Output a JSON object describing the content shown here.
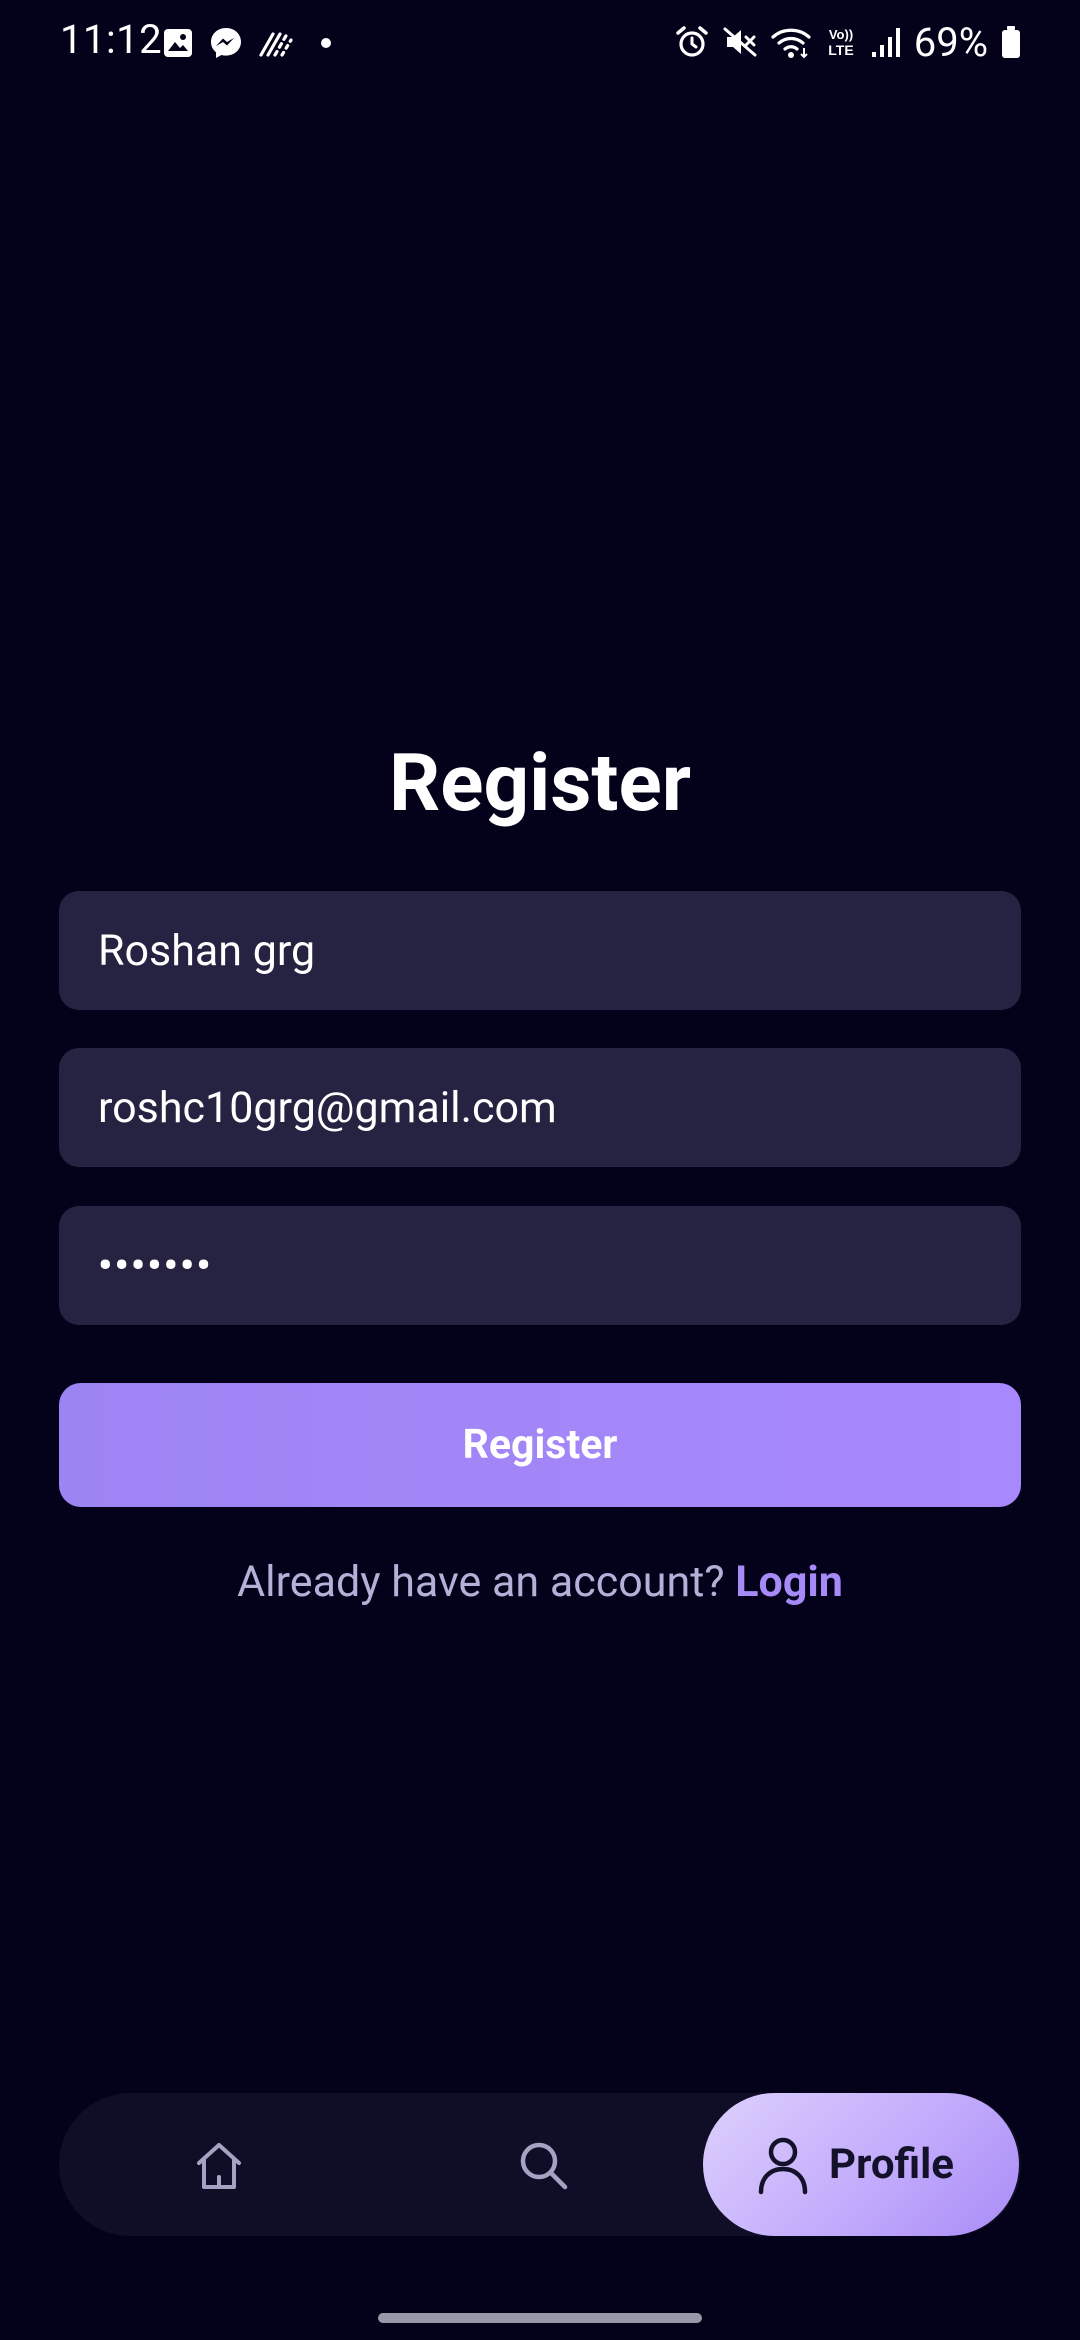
{
  "status_bar": {
    "time": "11:12",
    "battery_percent": "69%",
    "left_icons": [
      "gallery-icon",
      "messenger-icon",
      "slashes-icon",
      "dot-icon"
    ],
    "right_icons": [
      "alarm-icon",
      "mute-icon",
      "wifi-icon",
      "volte-icon",
      "signal-icon",
      "battery-icon"
    ]
  },
  "register": {
    "title": "Register",
    "name_value": "Roshan grg",
    "email_value": "roshc10grg@gmail.com",
    "password_value": "•••••••",
    "button_label": "Register",
    "login_prompt": "Already have an account?",
    "login_link": "Login"
  },
  "bottom_nav": {
    "items": [
      {
        "icon": "home-icon"
      },
      {
        "icon": "search-icon"
      },
      {
        "icon": "profile-icon",
        "label": "Profile",
        "active": true
      }
    ]
  },
  "colors": {
    "background": "#04021a",
    "field": "#252341",
    "accent": "#a68af8",
    "button": "#a889fd",
    "nav_bar": "#100e26"
  }
}
